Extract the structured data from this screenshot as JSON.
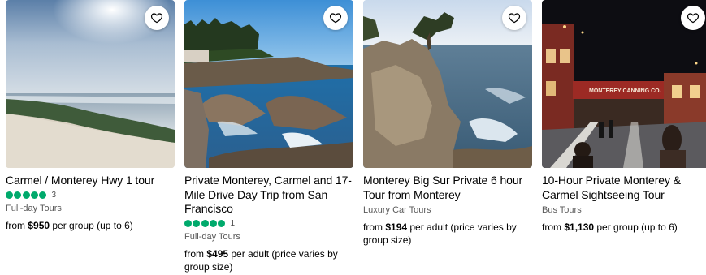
{
  "colors": {
    "rating_green": "#00aa6c",
    "text": "#000000",
    "muted": "#5a5a5a"
  },
  "cards": [
    {
      "image_desc_icon": "heart-icon",
      "title": "Carmel / Monterey Hwy 1 tour",
      "rating_bubbles": 5,
      "review_count": "3",
      "category": "Full-day Tours",
      "price_prefix": "from ",
      "price_amount": "$950",
      "price_suffix": " per group (up to 6)"
    },
    {
      "image_desc_icon": "heart-icon",
      "title": "Private Monterey, Carmel and 17-Mile Drive Day Trip from San Francisco",
      "rating_bubbles": 5,
      "review_count": "1",
      "category": "Full-day Tours",
      "price_prefix": "from ",
      "price_amount": "$495",
      "price_suffix": " per adult (price varies by group size)"
    },
    {
      "image_desc_icon": "heart-icon",
      "title": "Monterey Big Sur Private 6 hour Tour from Monterey",
      "category": "Luxury Car Tours",
      "price_prefix": "from ",
      "price_amount": "$194",
      "price_suffix": " per adult (price varies by group size)"
    },
    {
      "image_desc_icon": "heart-icon",
      "image_sign_text": "MONTEREY CANNING CO.",
      "title": "10-Hour Private Monterey & Carmel Sightseeing Tour",
      "category": "Bus Tours",
      "price_prefix": "from ",
      "price_amount": "$1,130",
      "price_suffix": " per group (up to 6)"
    }
  ]
}
